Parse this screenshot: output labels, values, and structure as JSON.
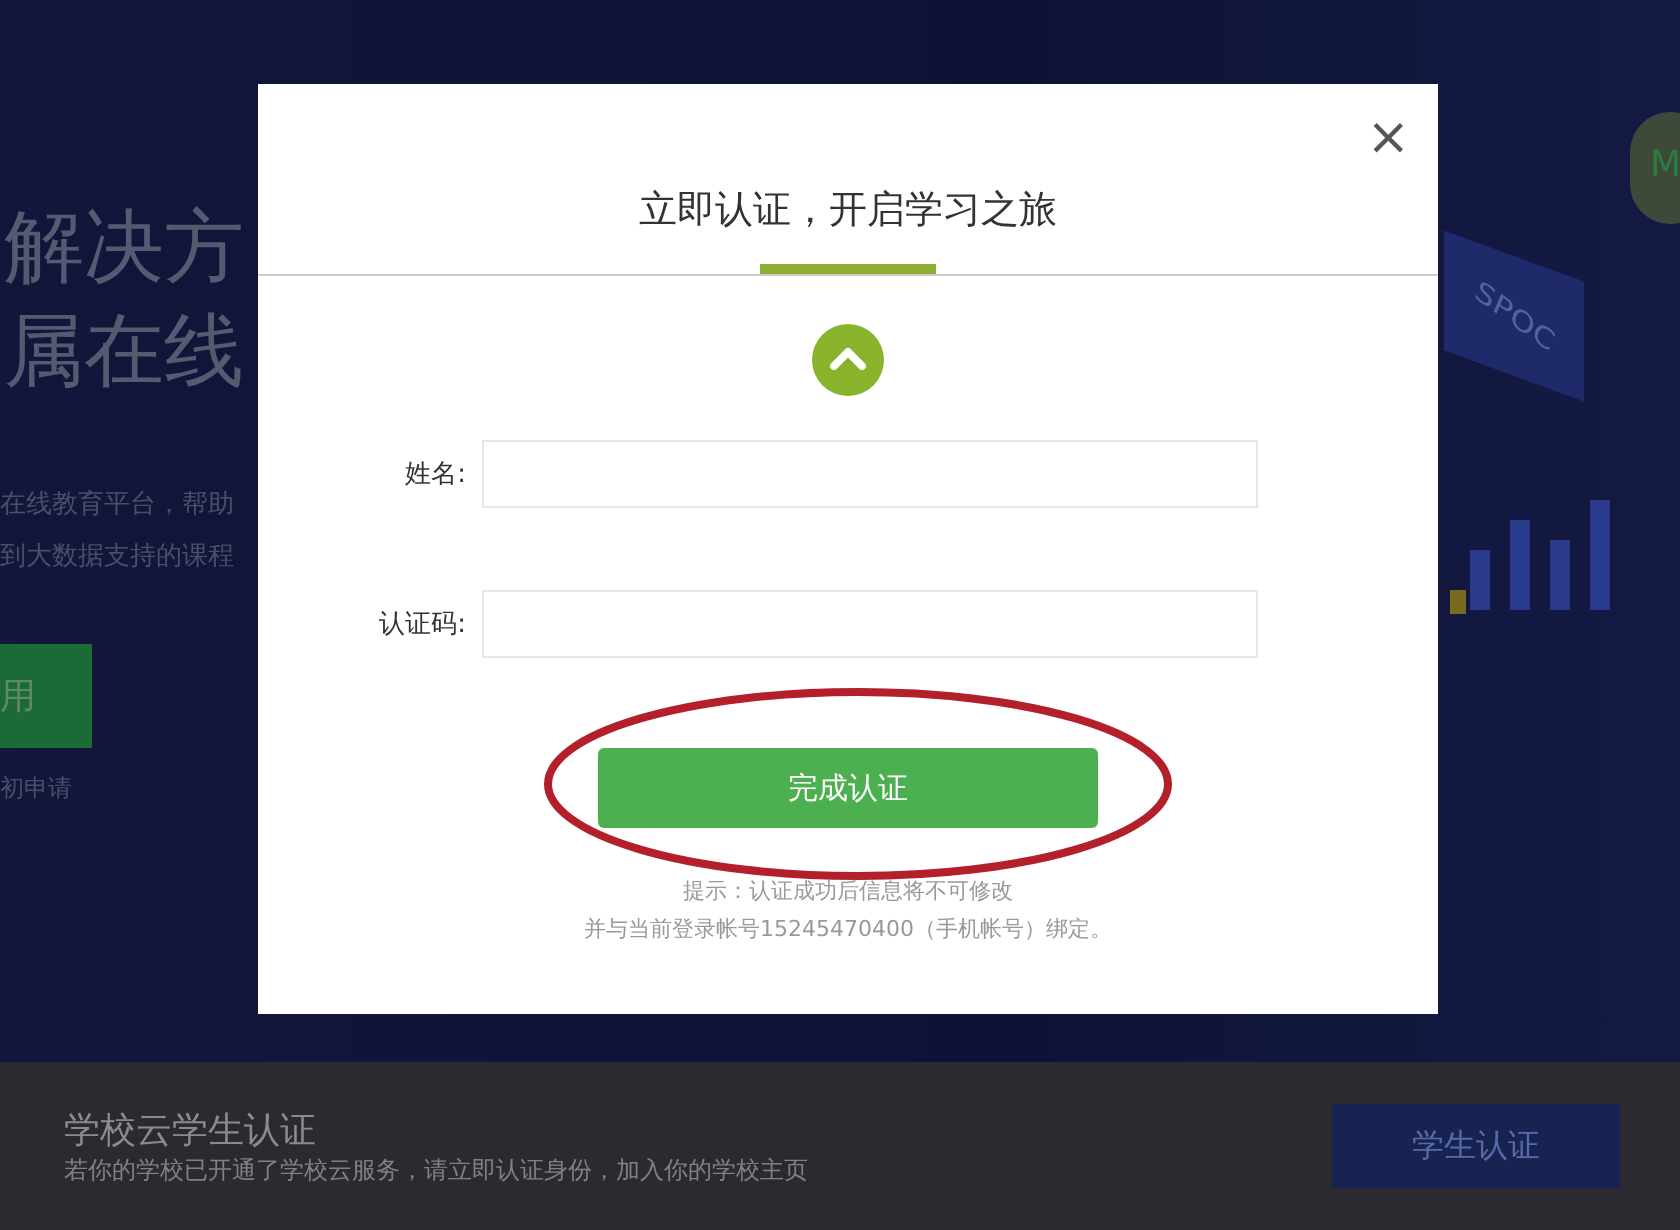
{
  "background": {
    "headline_lines": [
      "解决方",
      "属在线"
    ],
    "description_lines": [
      "在线教育平台，帮助",
      "到大数据支持的课程"
    ],
    "action_button": "用",
    "action_note": "初申请",
    "card_label": "SPOC",
    "badge_letter": "M"
  },
  "dialog": {
    "title": "立即认证，开启学习之旅",
    "close": "×",
    "fields": [
      {
        "label": "姓名:"
      },
      {
        "label": "认证码:"
      }
    ],
    "submit": "完成认证",
    "hints": [
      "提示：认证成功后信息将不可修改",
      "并与当前登录帐号15245470400（手机帐号）绑定。"
    ],
    "highlighted": true
  },
  "bottom_bar": {
    "title": "学校云学生认证",
    "subtitle": "若你的学校已开通了学校云服务，请立即认证身份，加入你的学校主页",
    "button": "学生认证"
  }
}
